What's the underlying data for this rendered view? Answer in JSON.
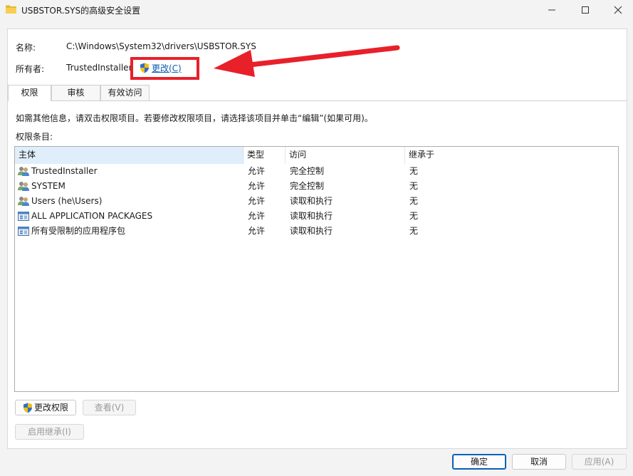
{
  "window": {
    "title": "USBSTOR.SYS的高级安全设置"
  },
  "name_row": {
    "label": "名称:",
    "value": "C:\\Windows\\System32\\drivers\\USBSTOR.SYS"
  },
  "owner_row": {
    "label": "所有者:",
    "value": "TrustedInstaller",
    "change_link": "更改(C)"
  },
  "tabs": [
    {
      "label": "权限",
      "active": true
    },
    {
      "label": "审核",
      "active": false
    },
    {
      "label": "有效访问",
      "active": false
    }
  ],
  "info_text": "如需其他信息，请双击权限项目。若要修改权限项目，请选择该项目并单击“编辑”(如果可用)。",
  "entries_label": "权限条目:",
  "columns": {
    "principal": "主体",
    "type": "类型",
    "access": "访问",
    "inherit": "继承于"
  },
  "entries": [
    {
      "principal": "TrustedInstaller",
      "type": "允许",
      "access": "完全控制",
      "inherit": "无",
      "icon": "users-icon"
    },
    {
      "principal": "SYSTEM",
      "type": "允许",
      "access": "完全控制",
      "inherit": "无",
      "icon": "users-icon"
    },
    {
      "principal": "Users (he\\Users)",
      "type": "允许",
      "access": "读取和执行",
      "inherit": "无",
      "icon": "users-icon"
    },
    {
      "principal": "ALL APPLICATION PACKAGES",
      "type": "允许",
      "access": "读取和执行",
      "inherit": "无",
      "icon": "app-packages-icon"
    },
    {
      "principal": "所有受限制的应用程序包",
      "type": "允许",
      "access": "读取和执行",
      "inherit": "无",
      "icon": "app-packages-icon"
    }
  ],
  "buttons": {
    "change_permissions": "更改权限",
    "view": "查看(V)",
    "enable_inheritance": "启用继承(I)",
    "ok": "确定",
    "cancel": "取消",
    "apply": "应用(A)"
  },
  "colors": {
    "annotation_red": "#e8202a",
    "link_blue": "#0a5fb4",
    "header_selected": "#dfeefa"
  }
}
